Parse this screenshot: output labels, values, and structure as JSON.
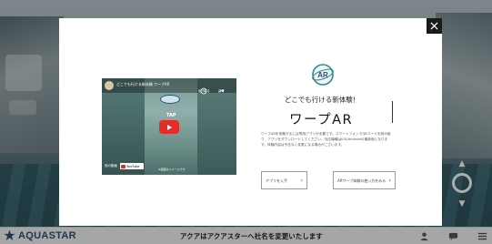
{
  "app": {
    "brand": "AQUASTAR",
    "bottom_notice": "アクアはアクアスターへ社名を変更いたします"
  },
  "modal": {
    "video": {
      "title": "どこでも行ける新体験 ワープAR",
      "watch_later_label": "後で見る",
      "share_label": "共有",
      "tap_label": "TAP",
      "more_label": "他の動画",
      "youtube_label": "YouTube",
      "caption": "※画面はイメージです"
    },
    "tagline": "どこでも行ける新体験！",
    "title": "ワープAR",
    "description": "ワープARを体験するには専用アプリが必要です。スマートフォンでQRコードを読み取り、アプリをダウンロードしてください。対応機種はiOS/Androidの最新版となります。体験内容は予告なく変更になる場合がございます。",
    "buttons": [
      {
        "label": "アプリを入手"
      },
      {
        "label": "ARワープ体験の使い方をみる"
      }
    ]
  },
  "colors": {
    "brand": "#2d4f7c",
    "play_red": "#e52d27",
    "close_bg": "#1a1a1a",
    "logo_teal": "#2f8a8a"
  },
  "icons": {
    "close": "close-icon",
    "play": "play-icon",
    "ar_logo": "warp-ar-logo-icon",
    "brand": "aquastar-logo-icon"
  }
}
